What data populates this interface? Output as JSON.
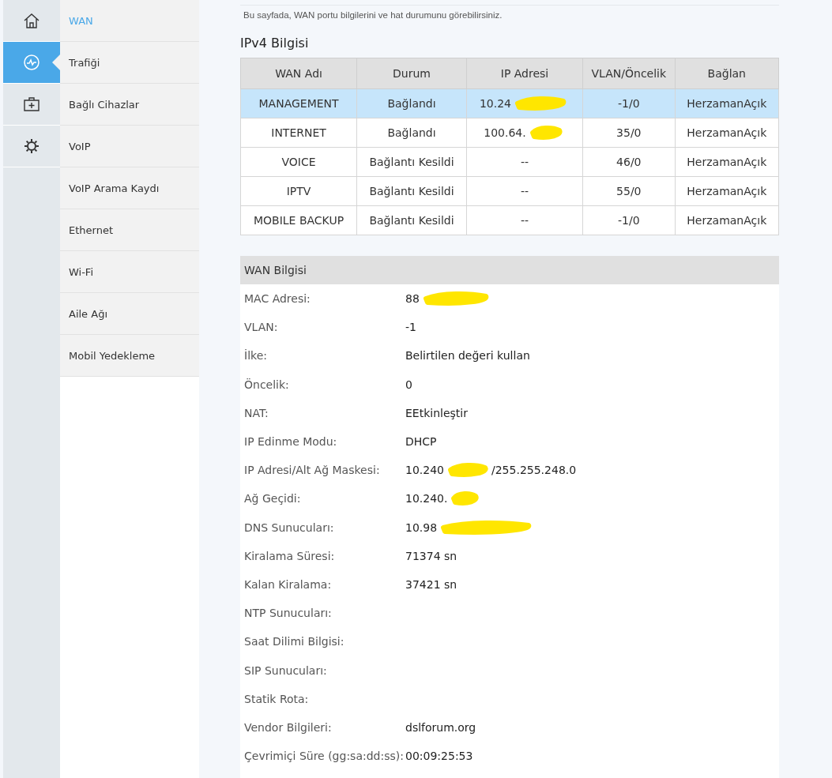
{
  "rail": [
    {
      "selected": false
    },
    {
      "selected": true
    },
    {
      "selected": false
    },
    {
      "selected": false
    }
  ],
  "submenu": [
    {
      "label": "WAN",
      "selected": true
    },
    {
      "label": "Trafiği",
      "selected": false
    },
    {
      "label": "Bağlı Cihazlar",
      "selected": false
    },
    {
      "label": "VoIP",
      "selected": false
    },
    {
      "label": "VoIP Arama Kaydı",
      "selected": false
    },
    {
      "label": "Ethernet",
      "selected": false
    },
    {
      "label": "Wi-Fi",
      "selected": false
    },
    {
      "label": "Aile Ağı",
      "selected": false
    },
    {
      "label": "Mobil Yedekleme",
      "selected": false
    }
  ],
  "description": "Bu sayfada, WAN portu bilgilerini ve hat durumunu görebilirsiniz.",
  "ipv4": {
    "title": "IPv4 Bilgisi",
    "columns": [
      "WAN Adı",
      "Durum",
      "IP Adresi",
      "VLAN/Öncelik",
      "Bağlan"
    ],
    "rows": [
      {
        "selected": true,
        "cells": [
          "MANAGEMENT",
          "Bağlandı",
          "10.24",
          "-1/0",
          "HerzamanAçık"
        ],
        "redacted": true
      },
      {
        "selected": false,
        "cells": [
          "INTERNET",
          "Bağlandı",
          "100.64.",
          "35/0",
          "HerzamanAçık"
        ],
        "redacted": true
      },
      {
        "selected": false,
        "cells": [
          "VOICE",
          "Bağlantı Kesildi",
          "--",
          "46/0",
          "HerzamanAçık"
        ],
        "redacted": false
      },
      {
        "selected": false,
        "cells": [
          "IPTV",
          "Bağlantı Kesildi",
          "--",
          "55/0",
          "HerzamanAçık"
        ],
        "redacted": false
      },
      {
        "selected": false,
        "cells": [
          "MOBILE BACKUP",
          "Bağlantı Kesildi",
          "--",
          "-1/0",
          "HerzamanAçık"
        ],
        "redacted": false
      }
    ]
  },
  "wan_info": {
    "title": "WAN Bilgisi",
    "rows": [
      {
        "label": "MAC Adresi:",
        "value": "88",
        "redacted": true
      },
      {
        "label": "VLAN:",
        "value": "-1",
        "redacted": false
      },
      {
        "label": "İlke:",
        "value": "Belirtilen değeri kullan",
        "redacted": false
      },
      {
        "label": "Öncelik:",
        "value": "0",
        "redacted": false
      },
      {
        "label": "NAT:",
        "value": "EEtkinleştir",
        "redacted": false
      },
      {
        "label": "IP Edinme Modu:",
        "value": "DHCP",
        "redacted": false
      },
      {
        "label": "IP Adresi/Alt Ağ Maskesi:",
        "value": "10.240",
        "redacted": true,
        "value_after": "/255.255.248.0"
      },
      {
        "label": "Ağ Geçidi:",
        "value": "10.240.",
        "redacted": true
      },
      {
        "label": "DNS Sunucuları:",
        "value": "10.98",
        "redacted": true
      },
      {
        "label": "Kiralama Süresi:",
        "value": "71374 sn",
        "redacted": false
      },
      {
        "label": "Kalan Kiralama:",
        "value": "37421 sn",
        "redacted": false
      },
      {
        "label": "NTP Sunucuları:",
        "redacted": false
      },
      {
        "label": "Saat Dilimi Bilgisi:",
        "redacted": false
      },
      {
        "label": "SIP Sunucuları:",
        "redacted": false
      },
      {
        "label": "Statik Rota:",
        "redacted": false
      },
      {
        "label": "Vendor Bilgileri:",
        "value": "dslforum.org",
        "redacted": false
      },
      {
        "label": "Çevrimiçi Süre (gg:sa:dd:ss):",
        "value": "00:09:25:53",
        "redacted": false
      }
    ]
  }
}
